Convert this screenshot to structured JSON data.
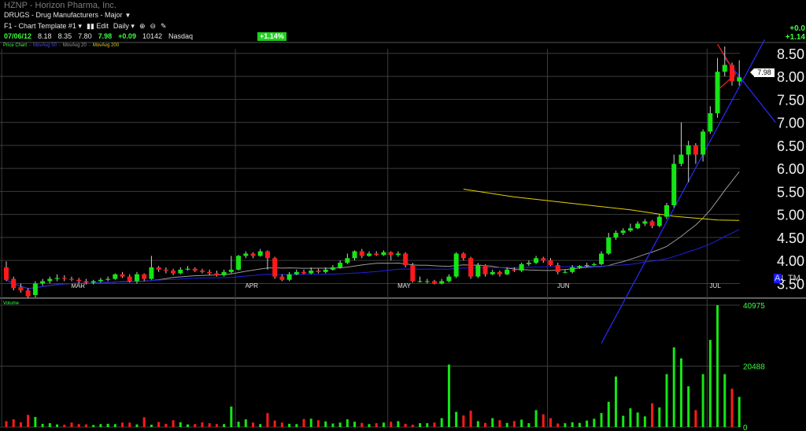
{
  "header": {
    "symbol_line": "HZNP - Horizon Pharma, Inc.",
    "industry": "DRUGS - Drug Manufacturers - Major",
    "template": "F1 - Chart Template #1",
    "edit_label": "Edit",
    "period_label": "Daily",
    "quote": {
      "date": "07/06/12",
      "open": "8.18",
      "high": "8.35",
      "low": "7.80",
      "close": "7.98",
      "change": "+0.09",
      "volume": "10142",
      "exchange": "Nasdaq"
    },
    "pct_badge": "+1.14%",
    "right_change": "+0.0",
    "right_pct": "+1.14"
  },
  "legend": {
    "price_chart": "Price Chart",
    "ma50": "MovAvg 50",
    "ma20": "MovAvg 20",
    "ma200": "MovAvg 200"
  },
  "volume_label": "Volume",
  "alt_text": {
    "a": "A",
    "rest": "L TM"
  },
  "colors": {
    "up": "#14e614",
    "down": "#ff1a1a",
    "ma20": "#9a9a9a",
    "ma50": "#2020e6",
    "ma200": "#e6d300",
    "grid": "#3c3c3c"
  },
  "chart_data": {
    "type": "candlestick",
    "price_axis": {
      "ticks": [
        "8.50",
        "8.00",
        "7.50",
        "7.00",
        "6.50",
        "6.00",
        "5.50",
        "5.00",
        "4.50",
        "4.00",
        "3.50"
      ],
      "range": [
        3.2,
        8.6
      ]
    },
    "volume_axis": {
      "ticks": [
        "40975",
        "20488",
        "0"
      ],
      "range": [
        0,
        40975
      ]
    },
    "month_labels": [
      "MAR",
      "APR",
      "MAY",
      "JUN",
      "JUL"
    ],
    "last_price": "7.98",
    "candles": [
      [
        3.85,
        3.58,
        3.98,
        3.55,
        2000
      ],
      [
        3.6,
        3.4,
        3.65,
        3.35,
        2600
      ],
      [
        3.42,
        3.35,
        3.5,
        3.3,
        1600
      ],
      [
        3.35,
        3.22,
        3.4,
        3.18,
        4100
      ],
      [
        3.25,
        3.5,
        3.55,
        3.2,
        3400
      ],
      [
        3.5,
        3.55,
        3.6,
        3.45,
        1100
      ],
      [
        3.55,
        3.6,
        3.65,
        3.5,
        1300
      ],
      [
        3.6,
        3.62,
        3.7,
        3.55,
        900
      ],
      [
        3.62,
        3.6,
        3.68,
        3.55,
        800
      ],
      [
        3.6,
        3.58,
        3.65,
        3.55,
        1500
      ],
      [
        3.58,
        3.55,
        3.62,
        3.5,
        1000
      ],
      [
        3.55,
        3.52,
        3.6,
        3.48,
        900
      ],
      [
        3.52,
        3.55,
        3.58,
        3.48,
        700
      ],
      [
        3.55,
        3.58,
        3.62,
        3.52,
        1000
      ],
      [
        3.58,
        3.6,
        3.65,
        3.55,
        1100
      ],
      [
        3.6,
        3.7,
        3.72,
        3.58,
        1000
      ],
      [
        3.7,
        3.65,
        3.75,
        3.62,
        1500
      ],
      [
        3.65,
        3.55,
        3.7,
        3.52,
        1500
      ],
      [
        3.55,
        3.7,
        3.75,
        3.5,
        900
      ],
      [
        3.7,
        3.6,
        3.72,
        3.55,
        3300
      ],
      [
        3.6,
        3.85,
        4.1,
        3.58,
        800
      ],
      [
        3.85,
        3.8,
        3.88,
        3.75,
        1700
      ],
      [
        3.8,
        3.78,
        3.85,
        3.72,
        1100
      ],
      [
        3.78,
        3.72,
        3.82,
        3.68,
        2300
      ],
      [
        3.72,
        3.8,
        3.85,
        3.7,
        1600
      ],
      [
        3.8,
        3.82,
        3.88,
        3.78,
        900
      ],
      [
        3.82,
        3.78,
        3.85,
        3.75,
        1000
      ],
      [
        3.78,
        3.75,
        3.82,
        3.72,
        1600
      ],
      [
        3.75,
        3.72,
        3.8,
        3.68,
        1300
      ],
      [
        3.72,
        3.68,
        3.78,
        3.65,
        1000
      ],
      [
        3.68,
        3.75,
        3.8,
        3.65,
        1000
      ],
      [
        3.75,
        3.8,
        4.1,
        3.72,
        6900
      ],
      [
        3.8,
        4.1,
        4.12,
        3.78,
        1800
      ],
      [
        4.1,
        4.15,
        4.2,
        4.05,
        2600
      ],
      [
        4.15,
        4.1,
        4.18,
        4.05,
        1500
      ],
      [
        4.1,
        4.2,
        4.25,
        4.08,
        1000
      ],
      [
        4.2,
        4.05,
        4.22,
        3.8,
        4700
      ],
      [
        4.05,
        3.65,
        4.08,
        3.6,
        2200
      ],
      [
        3.65,
        3.58,
        3.7,
        3.55,
        1500
      ],
      [
        3.58,
        3.7,
        3.75,
        3.55,
        1100
      ],
      [
        3.7,
        3.75,
        3.8,
        3.68,
        1000
      ],
      [
        3.75,
        3.72,
        3.8,
        3.7,
        2700
      ],
      [
        3.72,
        3.78,
        3.85,
        3.7,
        2800
      ],
      [
        3.78,
        3.75,
        3.82,
        3.72,
        2300
      ],
      [
        3.75,
        3.8,
        3.85,
        3.72,
        1900
      ],
      [
        3.8,
        3.85,
        3.9,
        3.78,
        1200
      ],
      [
        3.85,
        3.95,
        4.0,
        3.82,
        1500
      ],
      [
        3.95,
        4.05,
        4.15,
        3.92,
        2600
      ],
      [
        4.05,
        4.2,
        4.22,
        4.0,
        1800
      ],
      [
        4.2,
        4.1,
        4.25,
        4.05,
        1400
      ],
      [
        4.1,
        4.15,
        4.2,
        4.08,
        1000
      ],
      [
        4.15,
        4.12,
        4.2,
        4.1,
        1300
      ],
      [
        4.12,
        4.18,
        4.22,
        4.1,
        1500
      ],
      [
        4.18,
        4.12,
        4.2,
        4.0,
        1800
      ],
      [
        4.12,
        4.15,
        4.2,
        4.08,
        2000
      ],
      [
        4.15,
        3.9,
        4.18,
        3.85,
        1100
      ],
      [
        3.9,
        3.55,
        3.95,
        3.52,
        800
      ],
      [
        3.55,
        3.55,
        3.65,
        3.52,
        1300
      ],
      [
        3.55,
        3.55,
        3.6,
        3.5,
        1300
      ],
      [
        3.55,
        3.5,
        3.58,
        3.48,
        1500
      ],
      [
        3.5,
        3.55,
        3.6,
        3.48,
        3000
      ],
      [
        3.55,
        3.65,
        3.7,
        3.52,
        21000
      ],
      [
        3.65,
        4.15,
        4.18,
        3.62,
        5100
      ],
      [
        4.15,
        4.05,
        4.18,
        4.0,
        3900
      ],
      [
        4.05,
        3.65,
        4.08,
        3.6,
        5500
      ],
      [
        3.65,
        3.9,
        3.95,
        3.62,
        2000
      ],
      [
        3.9,
        3.7,
        3.92,
        3.65,
        1400
      ],
      [
        3.7,
        3.75,
        3.8,
        3.68,
        3000
      ],
      [
        3.75,
        3.7,
        3.78,
        3.65,
        2300
      ],
      [
        3.7,
        3.8,
        3.85,
        3.68,
        1400
      ],
      [
        3.8,
        3.78,
        3.85,
        3.75,
        2000
      ],
      [
        3.78,
        3.92,
        3.95,
        3.75,
        2500
      ],
      [
        3.92,
        3.95,
        4.0,
        3.88,
        1300
      ],
      [
        3.95,
        4.05,
        4.1,
        3.92,
        5700
      ],
      [
        4.05,
        4.0,
        4.08,
        3.95,
        4300
      ],
      [
        4.0,
        3.9,
        4.05,
        3.88,
        3000
      ],
      [
        3.9,
        3.75,
        3.95,
        3.7,
        1200
      ],
      [
        3.75,
        3.75,
        3.8,
        3.72,
        1300
      ],
      [
        3.75,
        3.85,
        3.9,
        3.72,
        1600
      ],
      [
        3.85,
        3.88,
        3.9,
        3.82,
        1400
      ],
      [
        3.88,
        3.9,
        3.95,
        3.85,
        2200
      ],
      [
        3.9,
        3.92,
        3.95,
        3.88,
        2800
      ],
      [
        3.92,
        4.15,
        4.2,
        3.9,
        4700
      ],
      [
        4.15,
        4.5,
        4.6,
        4.12,
        8500
      ],
      [
        4.5,
        4.6,
        4.65,
        4.45,
        17000
      ],
      [
        4.6,
        4.65,
        4.7,
        4.55,
        3800
      ],
      [
        4.65,
        4.7,
        4.8,
        4.62,
        6300
      ],
      [
        4.7,
        4.8,
        4.85,
        4.68,
        4900
      ],
      [
        4.8,
        4.85,
        4.9,
        4.75,
        3600
      ],
      [
        4.85,
        4.75,
        4.88,
        4.7,
        8000
      ],
      [
        4.75,
        4.95,
        5.0,
        4.72,
        6600
      ],
      [
        4.95,
        5.2,
        5.25,
        4.9,
        17800
      ],
      [
        5.2,
        6.1,
        6.3,
        5.15,
        26800
      ],
      [
        6.1,
        6.3,
        7.0,
        6.05,
        23100
      ],
      [
        6.3,
        6.5,
        6.6,
        5.7,
        13700
      ],
      [
        6.5,
        6.3,
        6.55,
        6.1,
        5700
      ],
      [
        6.3,
        6.8,
        6.85,
        6.15,
        17800
      ],
      [
        6.8,
        7.2,
        7.35,
        6.75,
        29300
      ],
      [
        7.2,
        8.1,
        8.4,
        7.1,
        40975
      ],
      [
        8.1,
        8.25,
        8.65,
        8.0,
        17800
      ],
      [
        8.25,
        7.9,
        8.3,
        7.8,
        12900
      ],
      [
        7.89,
        7.98,
        8.35,
        7.8,
        10142
      ]
    ]
  }
}
